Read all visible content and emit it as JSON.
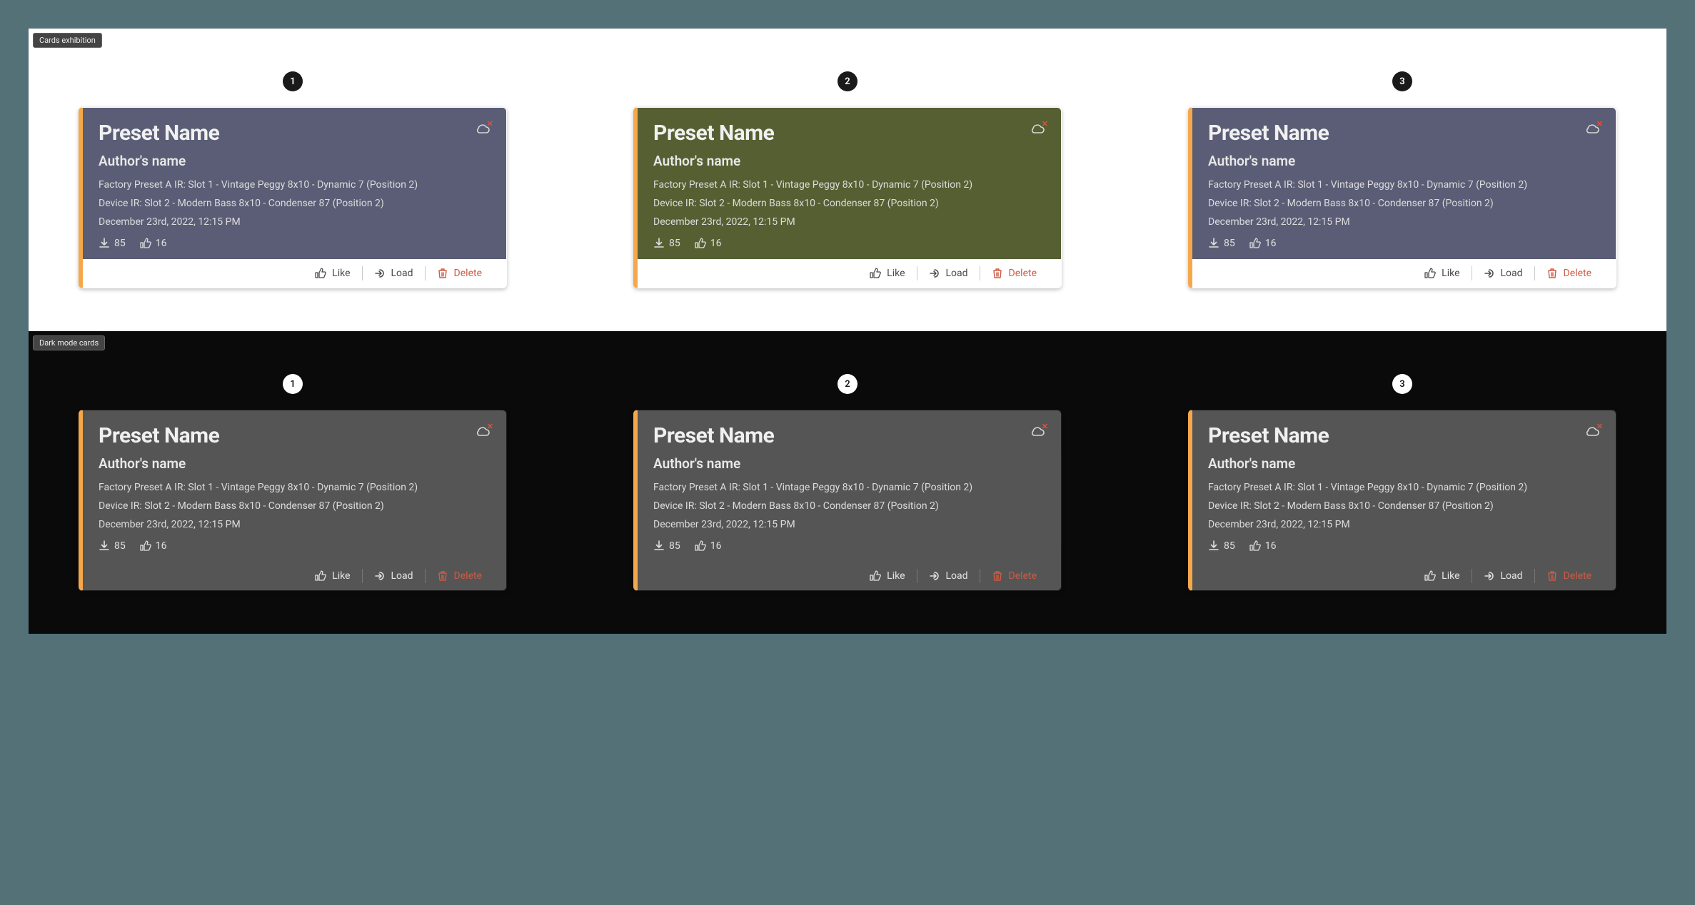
{
  "sections": [
    {
      "label": "Cards exhibition",
      "theme": "light",
      "cards": [
        {
          "variant": "blue"
        },
        {
          "variant": "green"
        },
        {
          "variant": "blue"
        }
      ]
    },
    {
      "label": "Dark mode cards",
      "theme": "dark",
      "cards": [
        {
          "variant": "grey"
        },
        {
          "variant": "grey"
        },
        {
          "variant": "grey"
        }
      ]
    }
  ],
  "card_content": {
    "title": "Preset Name",
    "author": "Author's name",
    "line1": "Factory Preset A IR: Slot 1 - Vintage Peggy 8x10 - Dynamic 7 (Position 2)",
    "line2": "Device IR: Slot 2 - Modern Bass 8x10 - Condenser 87 (Position 2)",
    "date": "December 23rd, 2022, 12:15 PM",
    "downloads": "85",
    "likes": "16"
  },
  "actions": {
    "like": "Like",
    "load": "Load",
    "delete": "Delete"
  },
  "badges": [
    "1",
    "2",
    "3"
  ]
}
